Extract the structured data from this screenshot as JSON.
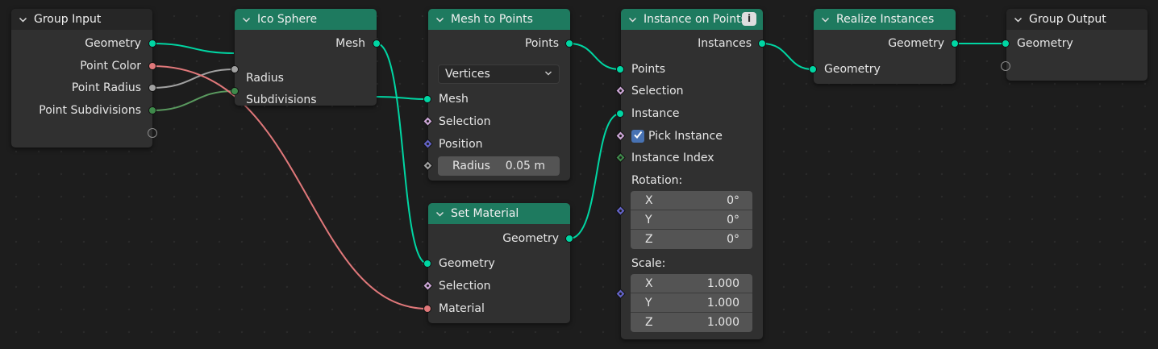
{
  "nodes": {
    "group_input": {
      "title": "Group Input",
      "outputs": [
        "Geometry",
        "Point Color",
        "Point Radius",
        "Point Subdivisions"
      ]
    },
    "ico_sphere": {
      "title": "Ico Sphere",
      "outputs": [
        "Mesh"
      ],
      "inputs": [
        "Radius",
        "Subdivisions"
      ]
    },
    "mesh_to_points": {
      "title": "Mesh to Points",
      "outputs": [
        "Points"
      ],
      "mode": "Vertices",
      "inputs": [
        "Mesh",
        "Selection",
        "Position"
      ],
      "radius": {
        "label": "Radius",
        "value": "0.05 m"
      }
    },
    "set_material": {
      "title": "Set Material",
      "outputs": [
        "Geometry"
      ],
      "inputs": [
        "Geometry",
        "Selection",
        "Material"
      ]
    },
    "instance_on_points": {
      "title": "Instance on Points",
      "outputs": [
        "Instances"
      ],
      "inputs": [
        "Points",
        "Selection",
        "Instance",
        "Pick Instance",
        "Instance Index"
      ],
      "pick_instance_checked": true,
      "rotation": {
        "label": "Rotation:",
        "rows": [
          {
            "axis": "X",
            "value": "0°"
          },
          {
            "axis": "Y",
            "value": "0°"
          },
          {
            "axis": "Z",
            "value": "0°"
          }
        ]
      },
      "scale": {
        "label": "Scale:",
        "rows": [
          {
            "axis": "X",
            "value": "1.000"
          },
          {
            "axis": "Y",
            "value": "1.000"
          },
          {
            "axis": "Z",
            "value": "1.000"
          }
        ]
      }
    },
    "realize_instances": {
      "title": "Realize Instances",
      "outputs": [
        "Geometry"
      ],
      "inputs": [
        "Geometry"
      ]
    },
    "group_output": {
      "title": "Group Output",
      "inputs": [
        "Geometry"
      ]
    }
  },
  "colors": {
    "geometry_socket": "#00d6a3",
    "color_socket": "#e0787a",
    "float_socket": "#a1a1a1",
    "int_socket": "#3f8a4b",
    "bool_socket": "#cca6d6",
    "vector_socket": "#6363c7",
    "header_geometry": "#1e7a5f",
    "header_group": "#262626"
  },
  "icons": {
    "collapse": "chevron-down-icon",
    "info": "info-icon",
    "check": "checkmark-icon"
  }
}
